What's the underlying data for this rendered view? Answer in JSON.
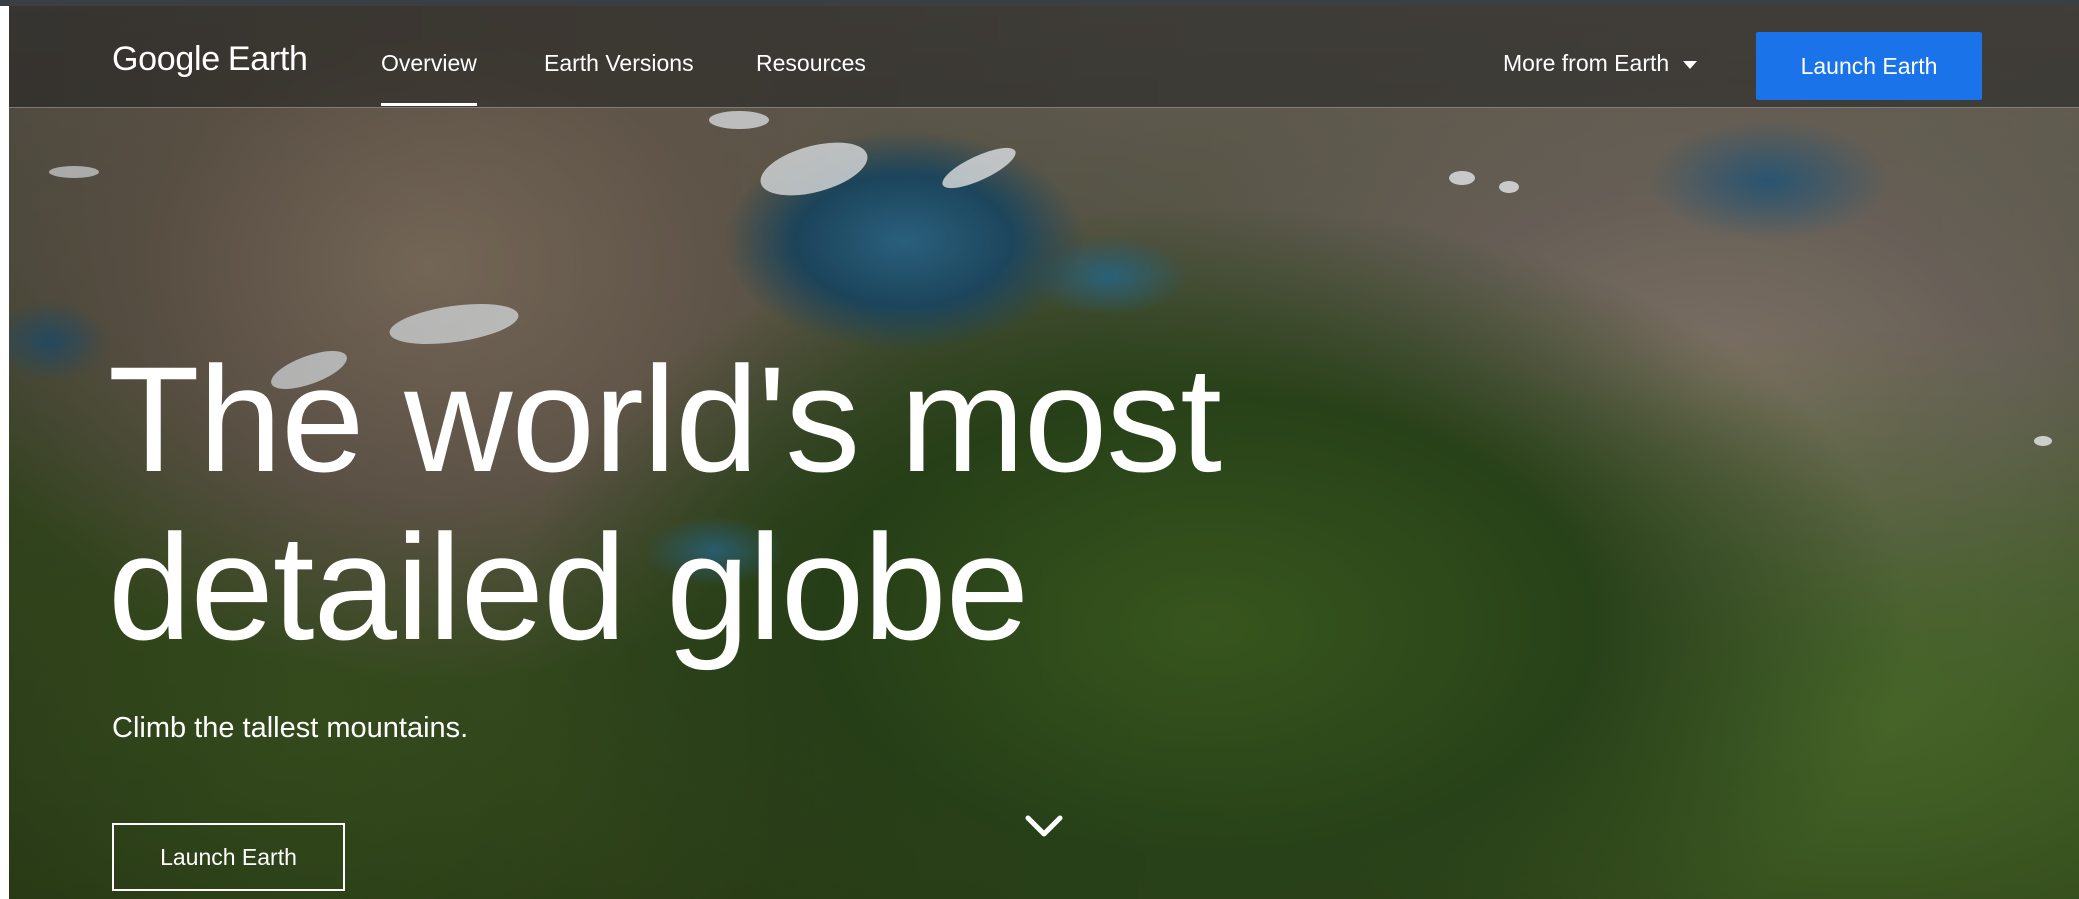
{
  "header": {
    "logo_google": "Google",
    "logo_earth": "Earth",
    "nav": [
      {
        "label": "Overview",
        "active": true
      },
      {
        "label": "Earth Versions",
        "active": false
      },
      {
        "label": "Resources",
        "active": false
      }
    ],
    "more_label": "More from Earth",
    "more_icon": "arrow-drop-down-icon",
    "launch_label": "Launch Earth"
  },
  "hero": {
    "headline_line1": "The world's most",
    "headline_line2": "detailed globe",
    "subtitle": "Climb the tallest mountains.",
    "cta_label": "Launch Earth",
    "scroll_icon": "chevron-down-icon",
    "background": "aerial-mountain-landscape-image"
  },
  "colors": {
    "accent": "#1a73e8",
    "text": "#ffffff"
  }
}
